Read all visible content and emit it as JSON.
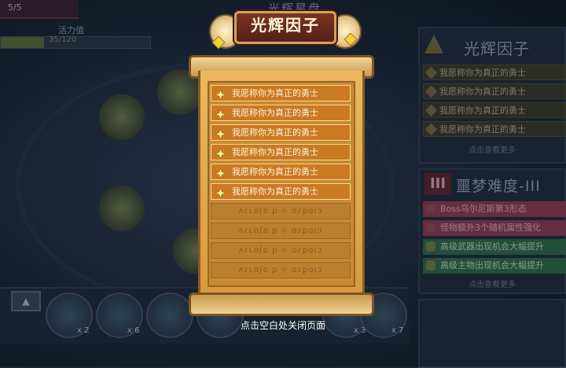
{
  "hud": {
    "stage": "5/5"
  },
  "background": {
    "title": "光辉星盘",
    "energy_label": "活力值",
    "energy_text": "35/120",
    "energy_fraction": 0.29
  },
  "bottom_bar": {
    "slots": [
      {
        "count": "x 2"
      },
      {
        "count": "x 6"
      },
      {
        "count": ""
      },
      {
        "count": ""
      },
      {
        "count": "x 3"
      },
      {
        "count": "x 7"
      }
    ]
  },
  "right_panel": {
    "factor_title": "光辉因子",
    "factor_items": [
      "我愿称你为真正的勇士",
      "我愿称你为真正的勇士",
      "我愿称你为真正的勇士",
      "我愿称你为真正的勇士"
    ],
    "factor_more": "点击查看更多",
    "difficulty_badge": "III",
    "difficulty_title": "噩梦难度-III",
    "difficulty_items": [
      {
        "text": "Boss乌尔尼斯第3形态",
        "color": "#8d3b52",
        "kind": "skull"
      },
      {
        "text": "怪物额外3个随机属性强化",
        "color": "#8d3b52",
        "kind": "skull"
      },
      {
        "text": "高级武器出现机会大幅提升",
        "color": "#2f6a48",
        "kind": "shield"
      },
      {
        "text": "高级主物出现机会大幅提升",
        "color": "#2f6a48",
        "kind": "shield"
      }
    ],
    "difficulty_more": "点击查看更多"
  },
  "modal": {
    "title": "光辉因子",
    "items": [
      {
        "text": "我愿称你为真正的勇士",
        "unlocked": true
      },
      {
        "text": "我愿称你为真正的勇士",
        "unlocked": true
      },
      {
        "text": "我愿称你为真正的勇士",
        "unlocked": true
      },
      {
        "text": "我愿称你为真正的勇士",
        "unlocked": true
      },
      {
        "text": "我愿称你为真正的勇士",
        "unlocked": true
      },
      {
        "text": "我愿称你为真正的勇士",
        "unlocked": true
      }
    ],
    "locked_rune": "ʌɾʟɑʃɒ ꝑ ⊹ ɑɾꝑɑɩɔ",
    "locked_count": 4,
    "close_hint": "点击空白处关闭页面"
  },
  "colors": {
    "scroll": "#dba148",
    "row_unlocked": "#c97a22",
    "row_border": "#fbd98e",
    "title_plate": "#6e2c1e"
  }
}
